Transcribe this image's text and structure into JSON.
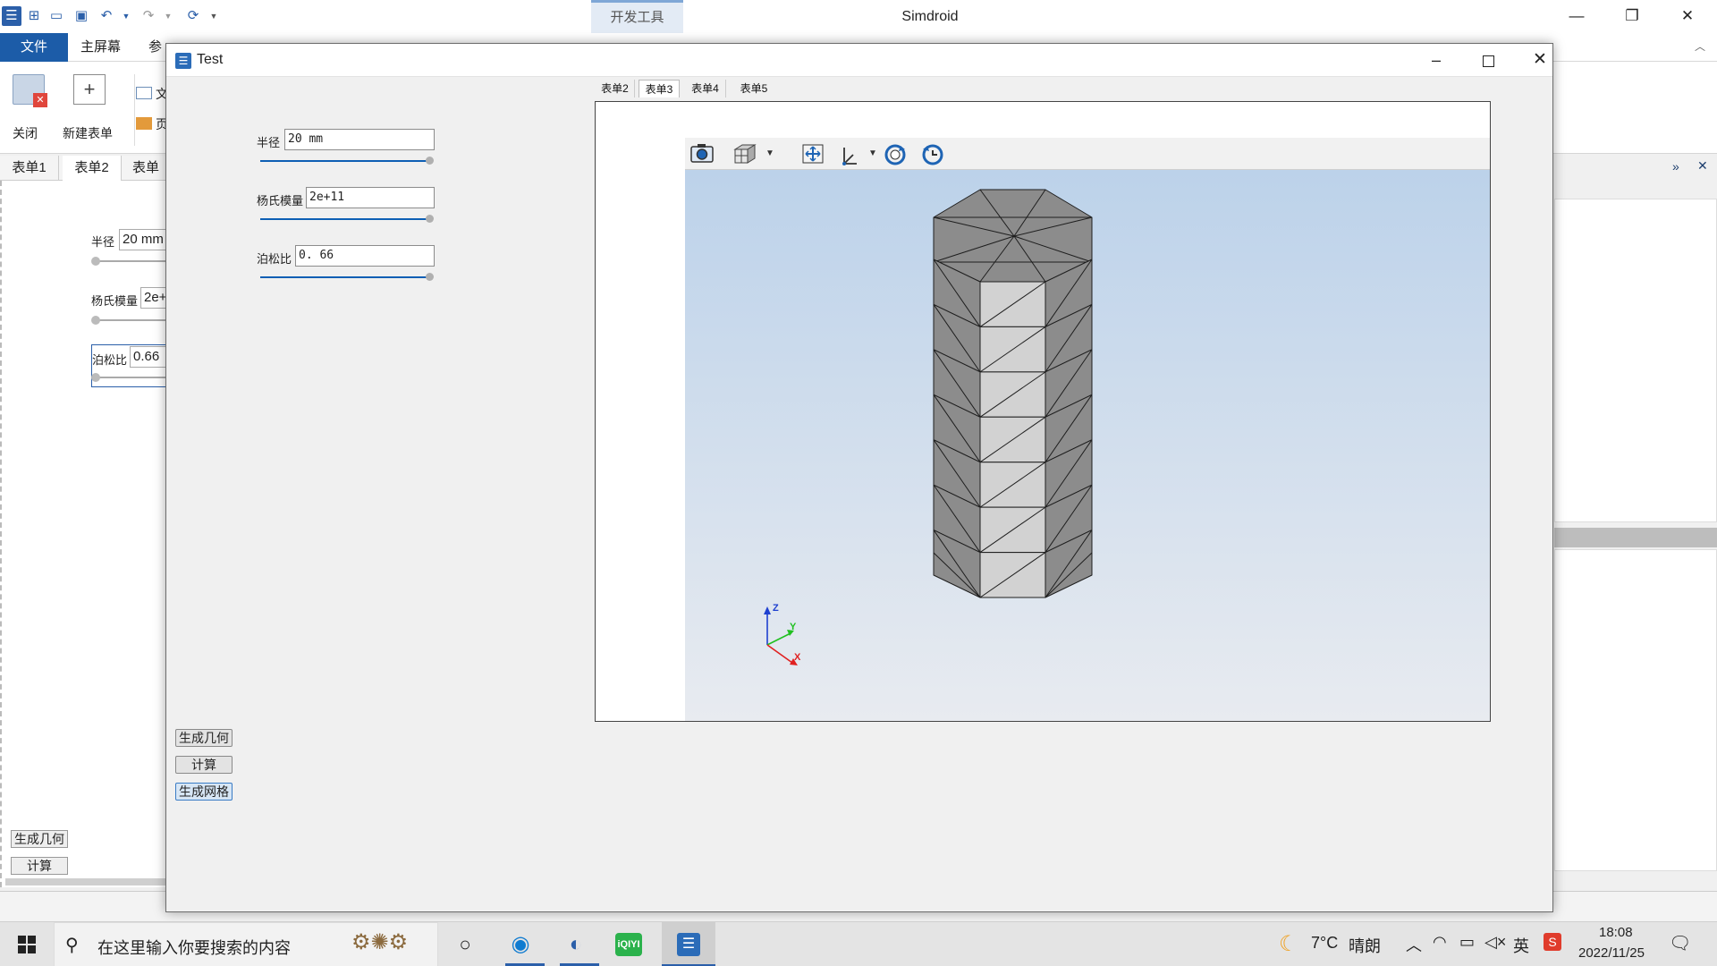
{
  "app": {
    "title": "Simdroid",
    "context_tab": "开发工具",
    "window_controls": {
      "minimize": "—",
      "restore": "❐",
      "close": "✕"
    },
    "quick_access": [
      "app-icon",
      "new-icon",
      "open-icon",
      "save-icon",
      "undo-icon",
      "redo-icon",
      "refresh-icon"
    ],
    "menu": {
      "file": "文件",
      "home": "主屏幕",
      "ref": "参"
    },
    "ribbon": {
      "close_label": "关闭",
      "new_form_label": "新建表单",
      "doc_label": "文",
      "page_label": "页"
    },
    "bottom_tabs": [
      "表单1",
      "表单2",
      "表单"
    ],
    "form": {
      "radius_label": "半径",
      "radius_value": "20 mm",
      "young_label": "杨氏模量",
      "young_value": "2e+",
      "poisson_label": "泊松比",
      "poisson_value": "0.66",
      "gen_geom": "生成几何",
      "compute": "计算"
    }
  },
  "dialog": {
    "title": "Test",
    "tabs": [
      "表单2",
      "表单3",
      "表单4",
      "表单5"
    ],
    "active_tab": 1,
    "fields": [
      {
        "label": "半径",
        "value": "20 mm",
        "slider": 1.0
      },
      {
        "label": "杨氏模量",
        "value": "2e+11",
        "slider": 1.0
      },
      {
        "label": "泊松比",
        "value": "0. 66",
        "slider": 1.0
      }
    ],
    "buttons": {
      "gen_geom": "生成几何",
      "compute": "计算",
      "gen_mesh": "生成网格"
    },
    "viewport_tools": [
      "camera-icon",
      "view-cube-icon",
      "fit-view-icon",
      "axis-orient-icon",
      "rotate-cw-icon",
      "rotate-ccw-icon"
    ],
    "triad": {
      "z": "Z",
      "y": "Y",
      "x": "X"
    }
  },
  "taskbar": {
    "search_placeholder": "在这里输入你要搜索的内容",
    "weather_temp": "7°C",
    "weather_desc": "晴朗",
    "ime": "英",
    "time": "18:08",
    "date": "2022/11/25"
  },
  "colors": {
    "accent": "#1e64b4",
    "active_menu": "#1c5ca8",
    "mesh_dark": "#8c8c8c",
    "mesh_light": "#d2d2d2",
    "slider": "#0d5fb4"
  }
}
